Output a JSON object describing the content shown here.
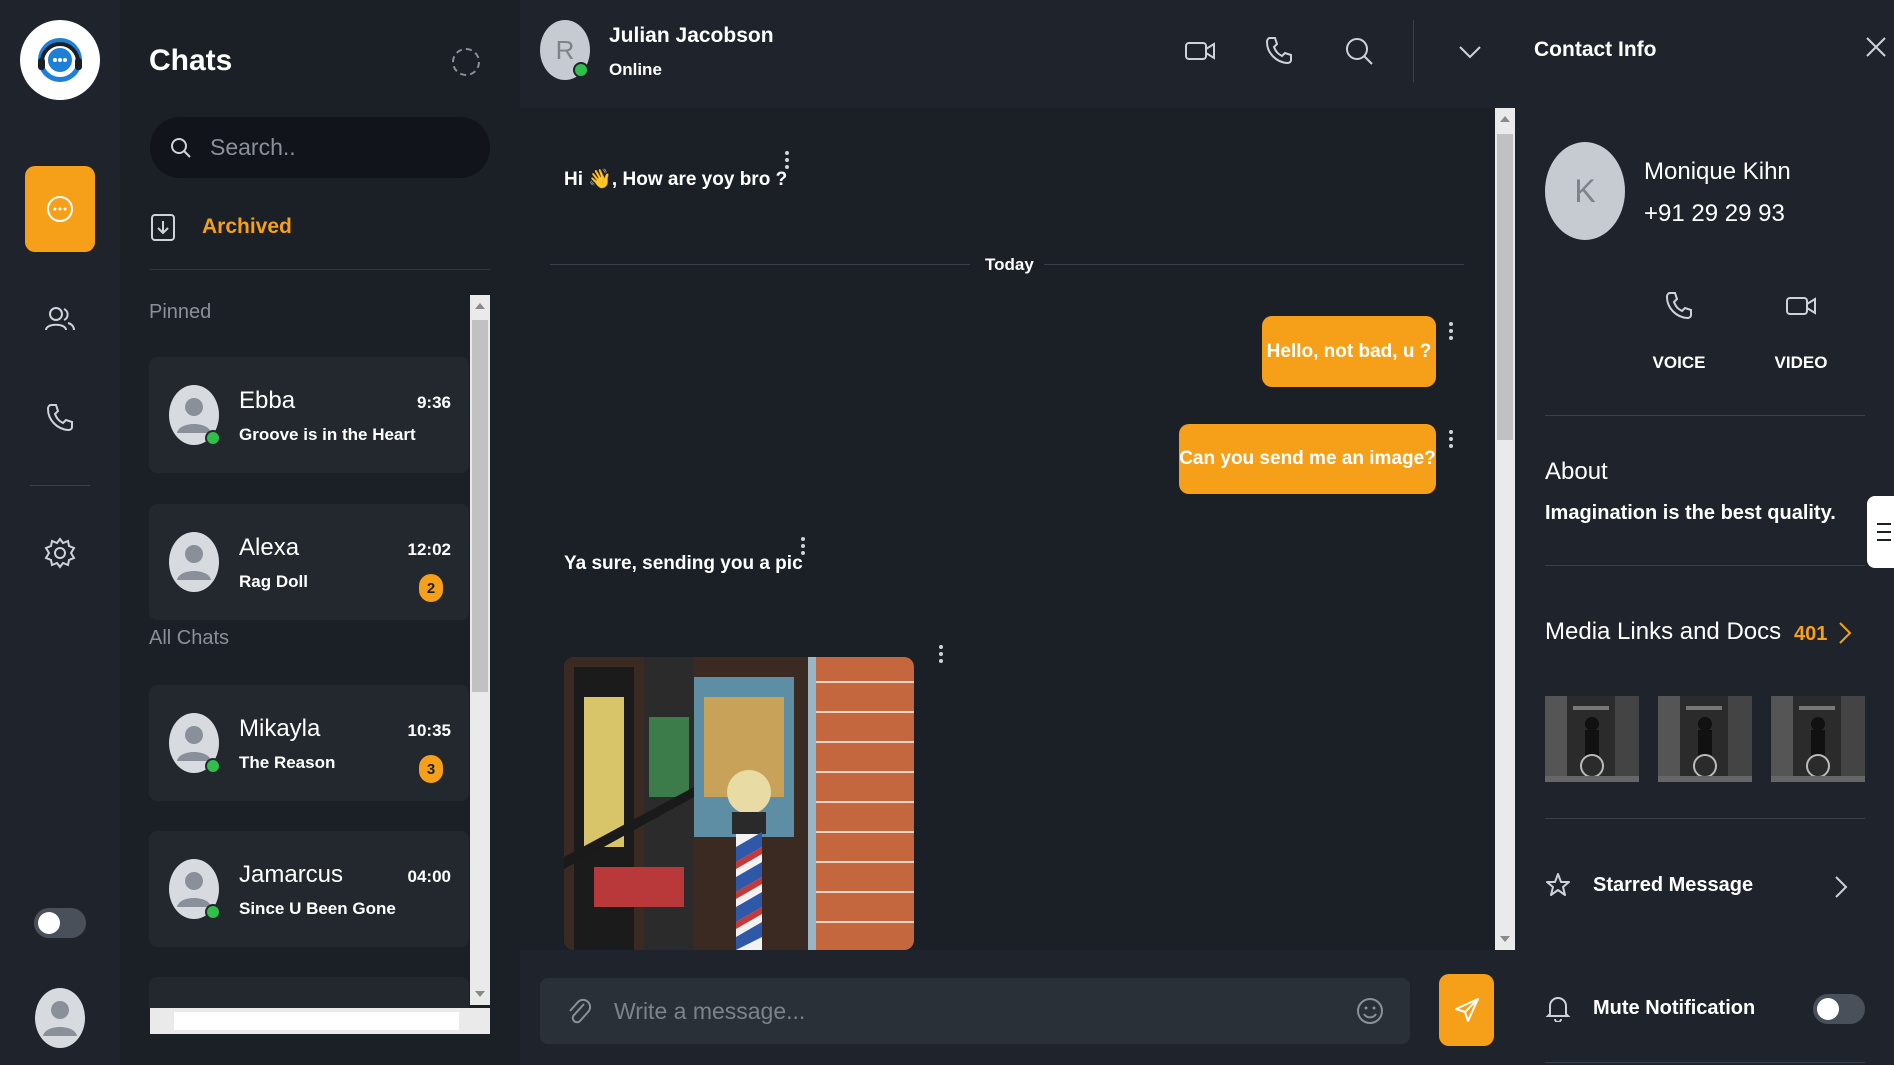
{
  "rail": {
    "nav": [
      {
        "name": "chats",
        "icon": "chat-bubble-icon",
        "active": true
      },
      {
        "name": "contacts",
        "icon": "users-icon",
        "active": false
      },
      {
        "name": "calls",
        "icon": "phone-icon",
        "active": false
      },
      {
        "name": "settings",
        "icon": "gear-icon",
        "active": false
      }
    ],
    "accent": "#f6a01a"
  },
  "chat_list": {
    "title": "Chats",
    "search_placeholder": "Search..",
    "archived_label": "Archived",
    "pinned_label": "Pinned",
    "all_chats_label": "All Chats",
    "pinned": [
      {
        "name": "Ebba",
        "message": "Groove is in the Heart",
        "time": "9:36",
        "online": true,
        "unread": ""
      },
      {
        "name": "Alexa",
        "message": "Rag Doll",
        "time": "12:02",
        "online": false,
        "unread": "2"
      }
    ],
    "all": [
      {
        "name": "Mikayla",
        "message": "The Reason",
        "time": "10:35",
        "online": true,
        "unread": "3"
      },
      {
        "name": "Jamarcus",
        "message": "Since U Been Gone",
        "time": "04:00",
        "online": true,
        "unread": ""
      }
    ]
  },
  "conversation": {
    "contact_initial": "R",
    "contact_name": "Julian Jacobson",
    "status": "Online",
    "messages": {
      "m1": "Hi 👋, How are yoy bro ?",
      "divider": "Today",
      "m2": "Hello, not bad, u ?",
      "m3": "Can you send me an image?",
      "m4": "Ya sure, sending you a pic"
    },
    "compose_placeholder": "Write a message..."
  },
  "contact_info": {
    "title": "Contact Info",
    "initial": "K",
    "name": "Monique Kihn",
    "phone": "+91 29 29 93",
    "voice_label": "VOICE",
    "video_label": "VIDEO",
    "about_heading": "About",
    "about_text": "Imagination is the best quality.",
    "media_heading": "Media Links and Docs",
    "media_count": "401",
    "starred_label": "Starred Message",
    "mute_label": "Mute Notification"
  }
}
